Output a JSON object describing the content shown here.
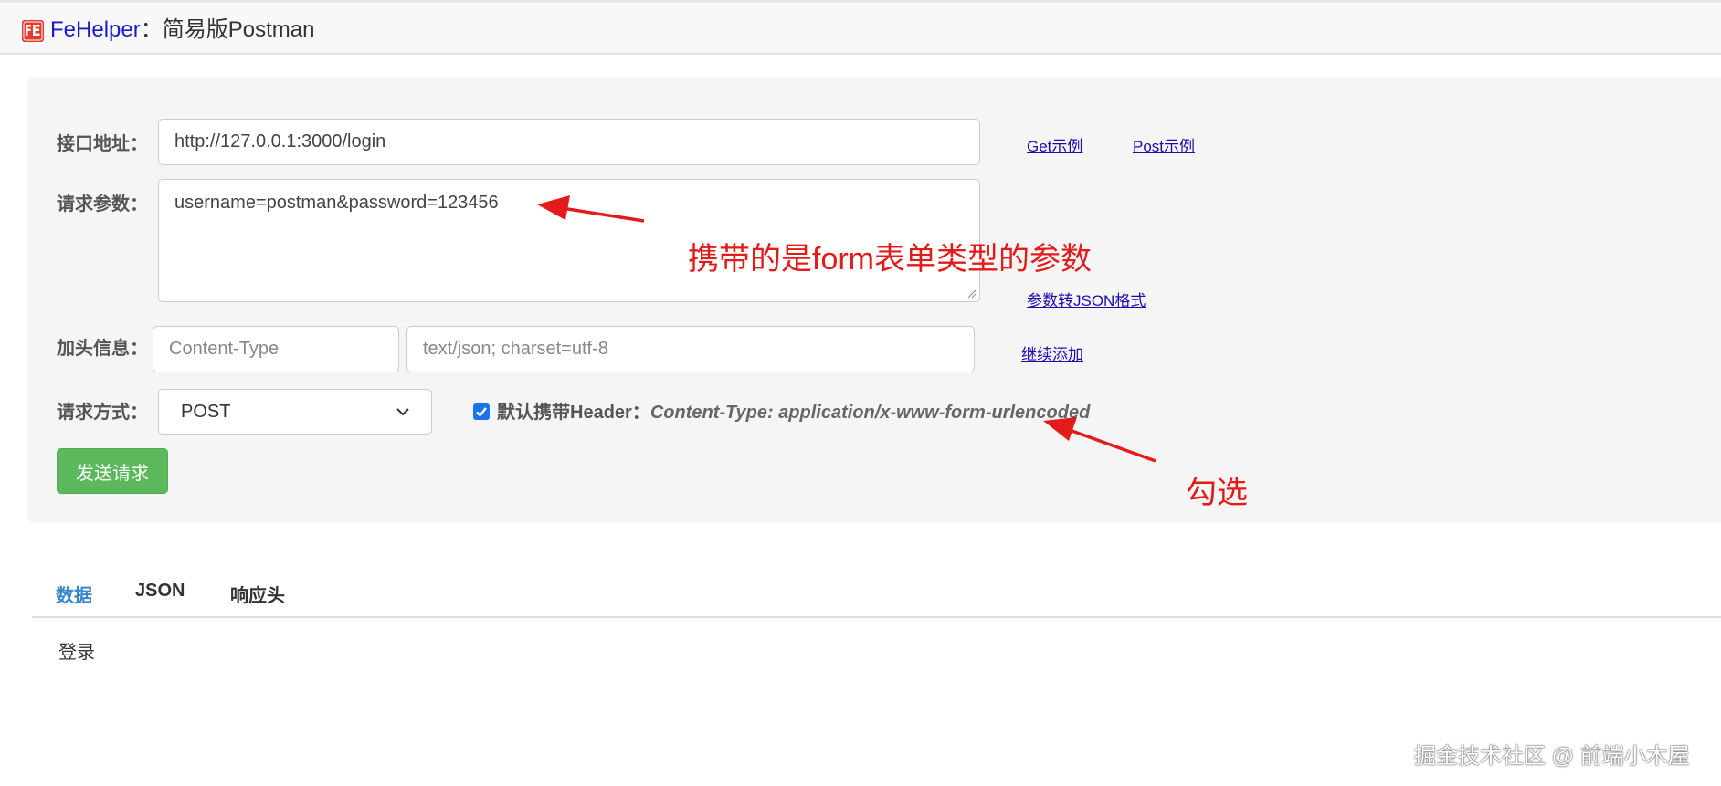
{
  "header": {
    "app_name": "FeHelper",
    "separator": "：",
    "tool_title": "简易版Postman"
  },
  "form": {
    "url_label": "接口地址：",
    "url_value": "http://127.0.0.1:3000/login",
    "get_example": "Get示例",
    "post_example": "Post示例",
    "params_label": "请求参数：",
    "params_value": "username=postman&password=123456",
    "params_to_json": "参数转JSON格式",
    "headers_label": "加头信息：",
    "header_key_placeholder": "Content-Type",
    "header_value_placeholder": "text/json; charset=utf-8",
    "add_more": "继续添加",
    "method_label": "请求方式：",
    "method_value": "POST",
    "default_header_label": "默认携带Header：",
    "default_header_value": "Content-Type: application/x-www-form-urlencoded",
    "default_header_checked": true,
    "send_button": "发送请求"
  },
  "annotations": {
    "params_note": "携带的是form表单类型的参数",
    "check_note": "勾选"
  },
  "result": {
    "tabs": [
      "数据",
      "JSON",
      "响应头"
    ],
    "active_tab": "数据",
    "content": "登录"
  },
  "watermark": "掘金技术社区 @ 前端小木屋",
  "colors": {
    "send_button": "#5cb85c",
    "link": "#1a0dab",
    "annotation": "#e31b1b",
    "active_tab": "#3a87c8",
    "checkbox": "#1a73e8"
  }
}
